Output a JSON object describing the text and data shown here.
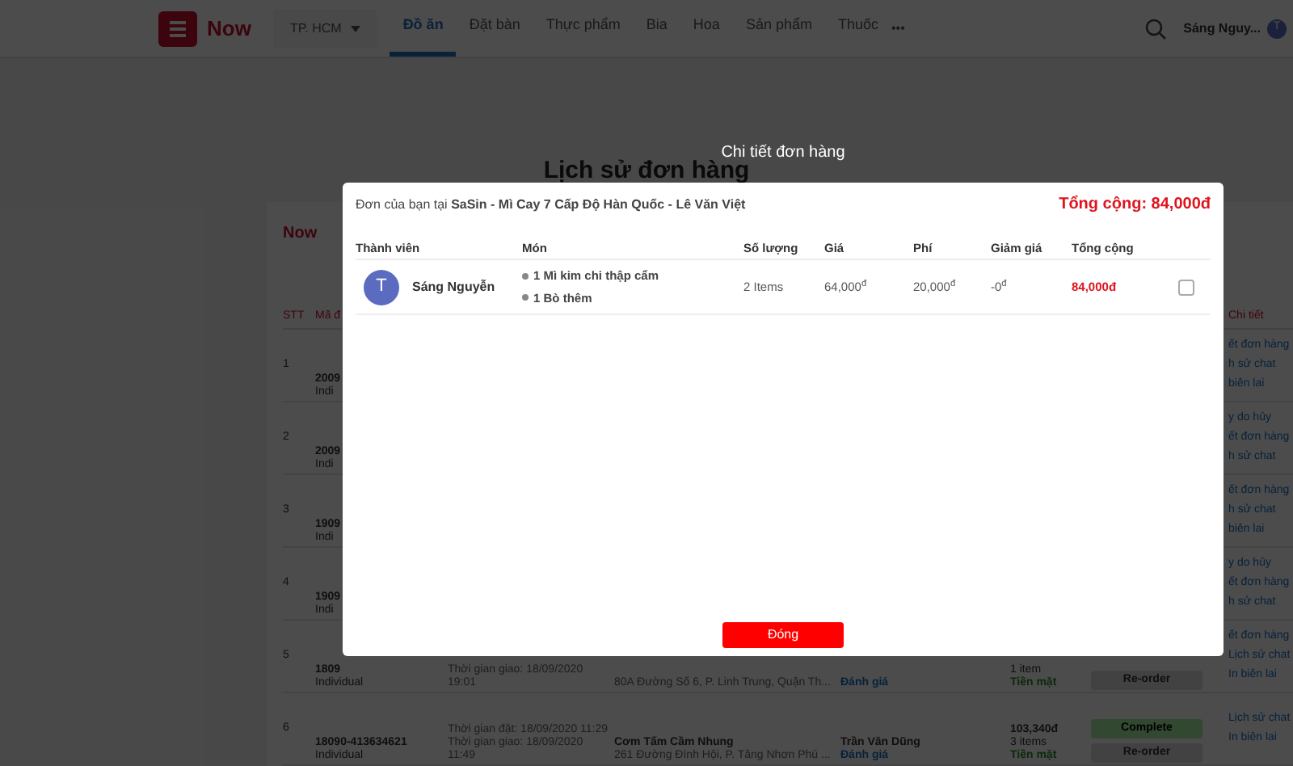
{
  "header": {
    "logo_text": "Now",
    "city": "TP. HCM",
    "tabs": [
      {
        "label": "Đồ ăn",
        "selected": true
      },
      {
        "label": "Đặt bàn",
        "selected": false
      },
      {
        "label": "Thực phẩm",
        "selected": false
      },
      {
        "label": "Bia",
        "selected": false
      },
      {
        "label": "Hoa",
        "selected": false
      },
      {
        "label": "Sản phẩm",
        "selected": false
      },
      {
        "label": "Thuốc",
        "selected": false
      }
    ],
    "more": "•••",
    "user_name": "Sáng Nguy...",
    "avatar_letter": "T"
  },
  "page_title": "Lịch sử đơn hàng",
  "orders": {
    "brand": "Now",
    "columns": [
      "STT",
      "Mã đ"
    ],
    "links_header": "Chi tiết",
    "rows": [
      {
        "stt": "1",
        "code": "2009",
        "type": "Indi",
        "links": [
          "ết đơn hàng",
          "h sử chat",
          "biên lai"
        ]
      },
      {
        "stt": "2",
        "code": "2009",
        "type": "Indi",
        "links": [
          "y do hủy",
          "ết đơn hàng",
          "h sử chat"
        ]
      },
      {
        "stt": "3",
        "code": "1909",
        "type": "Indi",
        "links": [
          "ết đơn hàng",
          "h sử chat",
          "biên lai"
        ]
      },
      {
        "stt": "4",
        "code": "1909",
        "type": "Indi",
        "links": [
          "y do hủy",
          "ết đơn hàng",
          "h sử chat"
        ]
      },
      {
        "stt": "5",
        "code": "1809",
        "type": "Individual",
        "time": [
          "Thời gian giao: 18/09/2020",
          "19:01"
        ],
        "restaurant": {
          "address": "80A Đường Số 6, P. Linh Trung, Quận Th..."
        },
        "shipper": {
          "review": "Đánh giá"
        },
        "total": {
          "lines": [
            "1 item"
          ],
          "payment": "Tiền mặt"
        },
        "actions": [
          "Re-order"
        ],
        "links": [
          "ết đơn hàng",
          "Lịch sử chat",
          "In biên lai"
        ]
      },
      {
        "stt": "6",
        "code": "18090-413634621",
        "type": "Individual",
        "time": [
          "Thời gian đặt: 18/09/2020 11:29",
          "Thời gian giao: 18/09/2020",
          "11:49"
        ],
        "restaurant": {
          "name": "Cơm Tấm Cầm Nhung",
          "address": "261 Đường Đình Hội, P. Tăng Nhơn Phú ..."
        },
        "shipper": {
          "name": "Trần Văn Dũng",
          "review": "Đánh giá"
        },
        "total": {
          "amount": "103,340đ",
          "lines": [
            "3 items"
          ],
          "payment": "Tiền mặt"
        },
        "status": "Complete",
        "actions": [
          "Re-order"
        ],
        "links": [
          "Lịch sử chat",
          "In biên lai"
        ]
      }
    ]
  },
  "modal": {
    "title": "Chi tiết đơn hàng",
    "store": "Đơn của bạn tại **SaSin - Mì Cay 7 Cấp Độ Hàn Quốc - Lê Văn Việt**",
    "grand_total": "Tổng cộng: 84,000đ",
    "columns": [
      "Thành viên",
      "Món",
      "Số lượng",
      "Giá",
      "Phí",
      "Giảm giá",
      "Tổng cộng"
    ],
    "members": [
      {
        "avatar_letter": "T",
        "name": "Sáng Nguyễn",
        "items": [
          "1 Mì kim chi thập cẩm",
          "1 Bò thêm"
        ],
        "quantity": "2 Items",
        "price": "64,000$^{đ}$",
        "fee": "20,000$^{đ}$",
        "discount": "-0$^{đ}$",
        "total": "84,000đ",
        "checked": false
      }
    ],
    "close_button": "Đóng"
  }
}
